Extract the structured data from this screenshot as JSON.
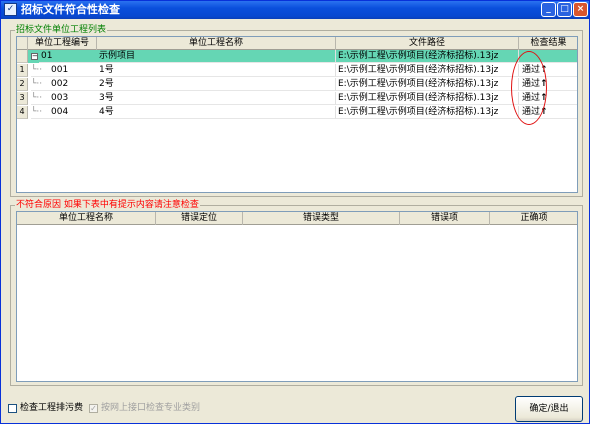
{
  "window": {
    "title": "招标文件符合性检查",
    "controls": {
      "minimize": "_",
      "maximize": "□",
      "close": "×"
    }
  },
  "upper_group": {
    "legend": "招标文件单位工程列表",
    "columns": [
      "单位工程编号",
      "单位工程名称",
      "文件路径",
      "检查结果"
    ],
    "parent_row": {
      "code": "01",
      "name": "示例项目",
      "path": "E:\\示例工程\\示例项目(经济标招标).13jz",
      "result": ""
    },
    "rows": [
      {
        "num": "1",
        "code": "001",
        "name": "1号",
        "path": "E:\\示例工程\\示例项目(经济标招标).13jz",
        "result": "通过"
      },
      {
        "num": "2",
        "code": "002",
        "name": "2号",
        "path": "E:\\示例工程\\示例项目(经济标招标).13jz",
        "result": "通过"
      },
      {
        "num": "3",
        "code": "003",
        "name": "3号",
        "path": "E:\\示例工程\\示例项目(经济标招标).13jz",
        "result": "通过"
      },
      {
        "num": "4",
        "code": "004",
        "name": "4号",
        "path": "E:\\示例工程\\示例项目(经济标招标).13jz",
        "result": "通过"
      }
    ]
  },
  "lower_group": {
    "legend": "不符合原因 如果下表中有提示内容请注意检查",
    "legend_color": "#ff0000",
    "columns": [
      "单位工程名称",
      "错误定位",
      "错误类型",
      "错误项",
      "正确项"
    ]
  },
  "bottom": {
    "check_fee_label": "检查工程排污费",
    "check_fee_checked": false,
    "online_check_label": "按网上接口检查专业类别",
    "online_check_checked": true,
    "online_check_enabled": false,
    "confirm_button": "确定/退出"
  },
  "colors": {
    "title_bar": "#0a4fdc",
    "selected_row": "#65d6b4",
    "window_bg": "#ece9d8",
    "annotation": "#e01010"
  }
}
